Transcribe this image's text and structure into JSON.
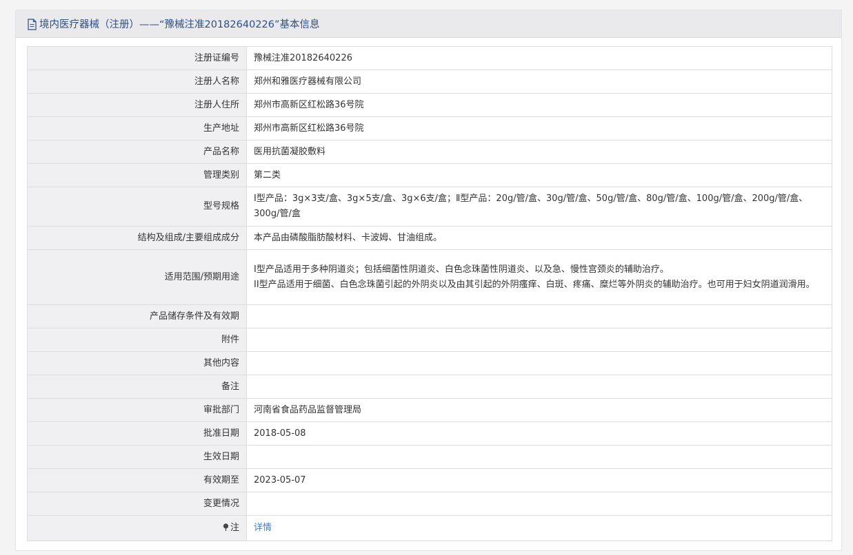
{
  "header": {
    "title": "境内医疗器械（注册）——“豫械注准20182640226”基本信息",
    "icon": "document-icon"
  },
  "rows": [
    {
      "label": "注册证编号",
      "value": "豫械注准20182640226"
    },
    {
      "label": "注册人名称",
      "value": "郑州和雅医疗器械有限公司"
    },
    {
      "label": "注册人住所",
      "value": "郑州市高新区红松路36号院"
    },
    {
      "label": "生产地址",
      "value": "郑州市高新区红松路36号院"
    },
    {
      "label": "产品名称",
      "value": "医用抗菌凝胶敷料"
    },
    {
      "label": "管理类别",
      "value": "第二类"
    },
    {
      "label": "型号规格",
      "value": "Ⅰ型产品：3g×3支/盒、3g×5支/盒、3g×6支/盒；Ⅱ型产品：20g/管/盒、30g/管/盒、50g/管/盒、80g/管/盒、100g/管/盒、200g/管/盒、300g/管/盒"
    },
    {
      "label": "结构及组成/主要组成成分",
      "value": "本产品由磷酸脂肪酸材料、卡波姆、甘油组成。"
    },
    {
      "label": "适用范围/预期用途",
      "lines": [
        "I型产品适用于多种阴道炎；包括细菌性阴道炎、白色念珠菌性阴道炎、以及急、慢性宫颈炎的辅助治疗。",
        "II型产品适用于细菌、白色念珠菌引起的外阴炎以及由其引起的外阴瘙痒、白斑、疼痛、糜烂等外阴炎的辅助治疗。也可用于妇女阴道润滑用。"
      ]
    },
    {
      "label": "产品储存条件及有效期",
      "value": ""
    },
    {
      "label": "附件",
      "value": ""
    },
    {
      "label": "其他内容",
      "value": ""
    },
    {
      "label": "备注",
      "value": ""
    },
    {
      "label": "审批部门",
      "value": "河南省食品药品监督管理局"
    },
    {
      "label": "批准日期",
      "value": "2018-05-08"
    },
    {
      "label": "生效日期",
      "value": ""
    },
    {
      "label": "有效期至",
      "value": "2023-05-07"
    },
    {
      "label": "变更情况",
      "value": ""
    }
  ],
  "note_row": {
    "label": "注",
    "icon": "pin-icon",
    "link": "详情"
  },
  "colors": {
    "header_text": "#2b4f86",
    "link": "#3a7fc4",
    "label_bg": "#f0f0f2"
  }
}
